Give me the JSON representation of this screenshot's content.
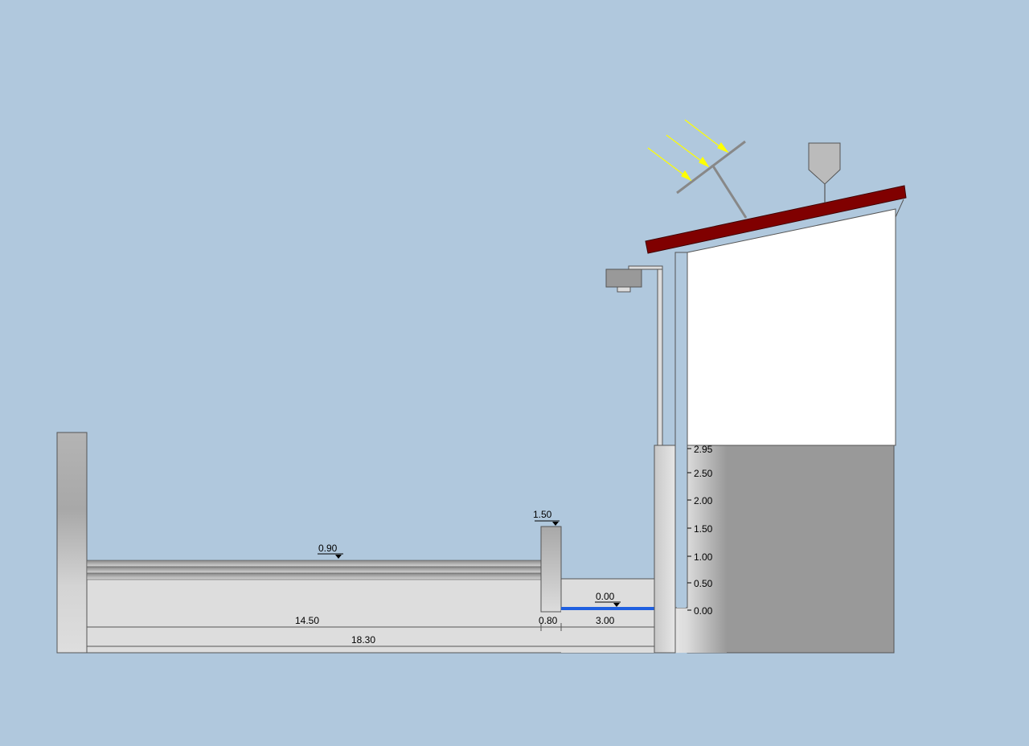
{
  "colors": {
    "background": "#b0c8dd",
    "roof": "#800000",
    "water": "#1f5fe0",
    "sun_rays": "#ffff00",
    "building": "#ffffff",
    "basement": "#999999",
    "concrete": "#d8d8d8"
  },
  "levels": {
    "wall_top": "1.50",
    "pool_surface": "0.90",
    "water_surface": "0.00"
  },
  "dimensions": {
    "pool_length": "14.50",
    "wall_thickness": "0.80",
    "channel_width": "3.00",
    "total_length": "18.30"
  },
  "depth_scale": [
    "2.95",
    "2.50",
    "2.00",
    "1.50",
    "1.00",
    "0.50",
    "0.00"
  ],
  "icons": {
    "solar_panel": "solar-panel-icon",
    "sun_rays": "sun-ray-arrow-icon",
    "hopper": "hopper-silo-icon",
    "lamp": "street-lamp-icon",
    "level_marker": "level-triangle-icon"
  }
}
